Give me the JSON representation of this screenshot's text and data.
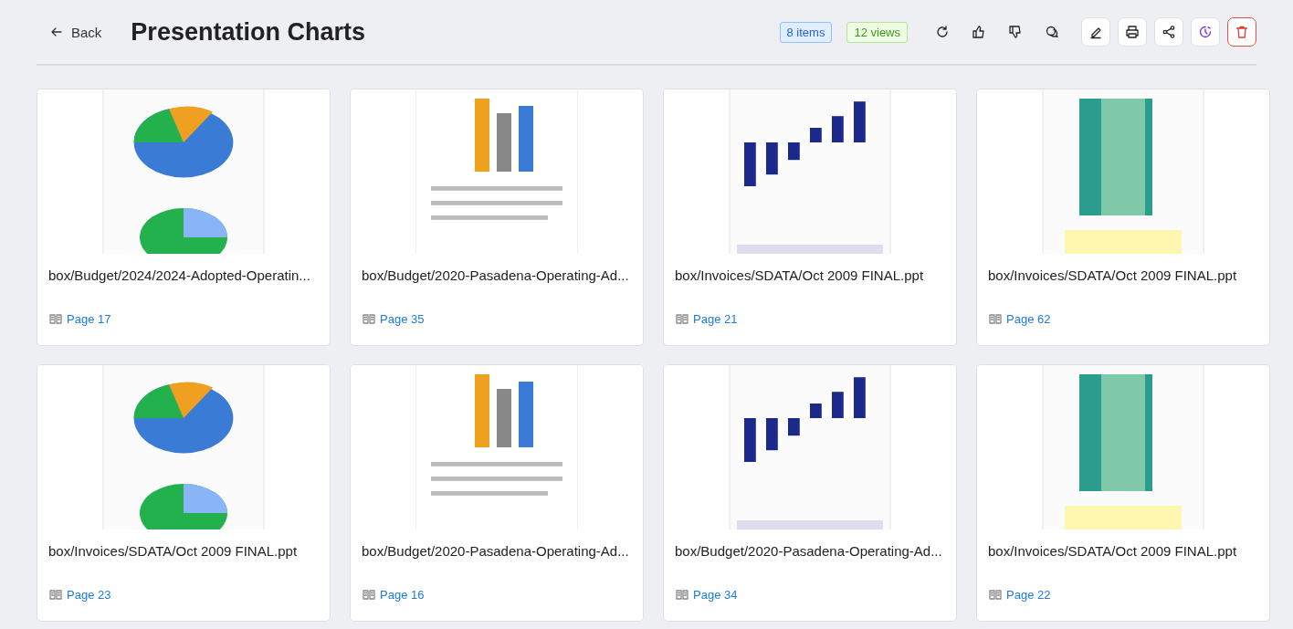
{
  "header": {
    "back": "Back",
    "title": "Presentation Charts",
    "items_badge": "8 items",
    "views_badge": "12 views"
  },
  "cards": [
    {
      "title": "box/Budget/2024/2024-Adopted-Operatin...",
      "page": "Page 17"
    },
    {
      "title": "box/Budget/2020-Pasadena-Operating-Ad...",
      "page": "Page 35"
    },
    {
      "title": "box/Invoices/SDATA/Oct 2009 FINAL.ppt",
      "page": "Page 21"
    },
    {
      "title": "box/Invoices/SDATA/Oct 2009 FINAL.ppt",
      "page": "Page 62"
    },
    {
      "title": "box/Invoices/SDATA/Oct 2009 FINAL.ppt",
      "page": "Page 23"
    },
    {
      "title": "box/Budget/2020-Pasadena-Operating-Ad...",
      "page": "Page 16"
    },
    {
      "title": "box/Budget/2020-Pasadena-Operating-Ad...",
      "page": "Page 34"
    },
    {
      "title": "box/Invoices/SDATA/Oct 2009 FINAL.ppt",
      "page": "Page 22"
    }
  ]
}
